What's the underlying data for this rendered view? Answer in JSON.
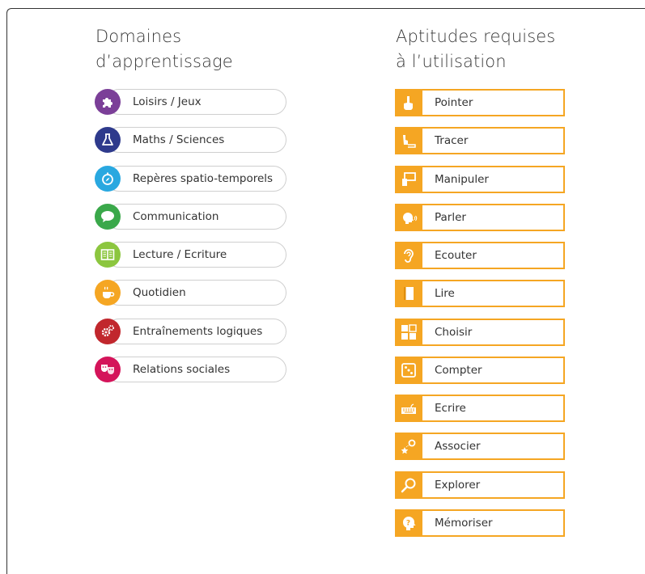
{
  "domains_title": "Domaines\nd’apprentissage",
  "skills_title": "Aptitudes requises\nà l’utilisation",
  "domains": [
    {
      "label": "Loisirs / Jeux",
      "color": "#7b3f98",
      "icon": "puzzle-icon"
    },
    {
      "label": "Maths / Sciences",
      "color": "#2e3a8c",
      "icon": "flask-icon"
    },
    {
      "label": "Repères spatio-temporels",
      "color": "#29a8e0",
      "icon": "compass-icon"
    },
    {
      "label": "Communication",
      "color": "#3aa84a",
      "icon": "speech-bubble-icon"
    },
    {
      "label": "Lecture / Ecriture",
      "color": "#8cc63f",
      "icon": "book-icon"
    },
    {
      "label": "Quotidien",
      "color": "#f5a623",
      "icon": "cup-icon"
    },
    {
      "label": "Entraînements logiques",
      "color": "#c1272d",
      "icon": "gears-icon"
    },
    {
      "label": "Relations sociales",
      "color": "#d4145a",
      "icon": "masks-icon"
    }
  ],
  "skills": [
    {
      "label": "Pointer",
      "icon": "pointing-hand-icon"
    },
    {
      "label": "Tracer",
      "icon": "tracing-hand-icon"
    },
    {
      "label": "Manipuler",
      "icon": "grabbing-hand-icon"
    },
    {
      "label": "Parler",
      "icon": "speaking-head-icon"
    },
    {
      "label": "Ecouter",
      "icon": "ear-icon"
    },
    {
      "label": "Lire",
      "icon": "book-icon"
    },
    {
      "label": "Choisir",
      "icon": "choice-grid-icon"
    },
    {
      "label": "Compter",
      "icon": "dice-icon"
    },
    {
      "label": "Ecrire",
      "icon": "keyboard-icon"
    },
    {
      "label": "Associer",
      "icon": "star-link-icon"
    },
    {
      "label": "Explorer",
      "icon": "magnifier-icon"
    },
    {
      "label": "Mémoriser",
      "icon": "brain-head-icon"
    }
  ],
  "skill_color": "#f5a623"
}
